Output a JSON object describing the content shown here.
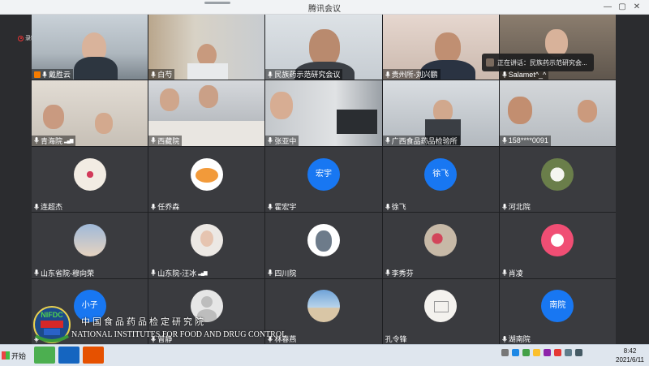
{
  "window": {
    "title": "腾讯会议"
  },
  "recording": {
    "label": "录制中"
  },
  "speaking_panel": {
    "text": "正在讲话：民族药示范研究会..."
  },
  "participants": [
    {
      "name": "戴胜云",
      "type": "video",
      "scene": "office_woman",
      "badge": true
    },
    {
      "name": "白芍",
      "type": "video",
      "scene": "lab"
    },
    {
      "name": "民族药示范研究会议",
      "type": "video",
      "scene": "man_glasses",
      "speaking": true
    },
    {
      "name": "贵州所-刘兴鹏",
      "type": "video",
      "scene": "man_suit"
    },
    {
      "name": "Salamet^_^",
      "type": "video",
      "scene": "woman_room"
    },
    {
      "name": "青海院",
      "type": "video",
      "scene": "group",
      "signal": true
    },
    {
      "name": "西藏院",
      "type": "video",
      "scene": "meeting_table"
    },
    {
      "name": "张亚中",
      "type": "video",
      "scene": "woman_screen"
    },
    {
      "name": "广西食品药品检验所",
      "type": "video",
      "scene": "office_desk"
    },
    {
      "name": "158****0091",
      "type": "video",
      "scene": "two_men"
    },
    {
      "name": "连超杰",
      "type": "avatar",
      "avatar": "floral"
    },
    {
      "name": "任乔森",
      "type": "avatar",
      "avatar": "cartoon"
    },
    {
      "name": "霍宏宇",
      "type": "avatar",
      "avatar_text": "宏宇"
    },
    {
      "name": "徐飞",
      "type": "avatar",
      "avatar_text": "徐飞"
    },
    {
      "name": "河北院",
      "type": "avatar",
      "avatar": "flower"
    },
    {
      "name": "山东省院-穆向荣",
      "type": "avatar",
      "avatar": "couple"
    },
    {
      "name": "山东院-汪冰",
      "type": "avatar",
      "avatar": "girl",
      "signal": true
    },
    {
      "name": "四川院",
      "type": "avatar",
      "avatar": "totoro"
    },
    {
      "name": "李秀芬",
      "type": "avatar",
      "avatar": "blossom"
    },
    {
      "name": "肖凌",
      "type": "avatar",
      "avatar": "pink"
    },
    {
      "name": "",
      "type": "avatar",
      "avatar_text": "小子"
    },
    {
      "name": "曾静",
      "type": "avatar",
      "avatar": "person"
    },
    {
      "name": "林春燕",
      "type": "avatar",
      "avatar": "beach"
    },
    {
      "name": "孔令锋",
      "type": "avatar",
      "avatar": "sketch",
      "no_mic": true
    },
    {
      "name": "湖南院",
      "type": "avatar",
      "avatar_text": "南院"
    }
  ],
  "watermark": {
    "logo_text": "NIFDC",
    "cn": "中国食品药品检定研究院",
    "en": "NATIONAL INSTITUTES FOR FOOD AND DRUG CONTROL"
  },
  "taskbar": {
    "start_label": "开始",
    "time": "8:42",
    "date": "2021/6/11"
  },
  "colors": {
    "accent": "#1877f2",
    "speaking": "#3fd16b"
  }
}
